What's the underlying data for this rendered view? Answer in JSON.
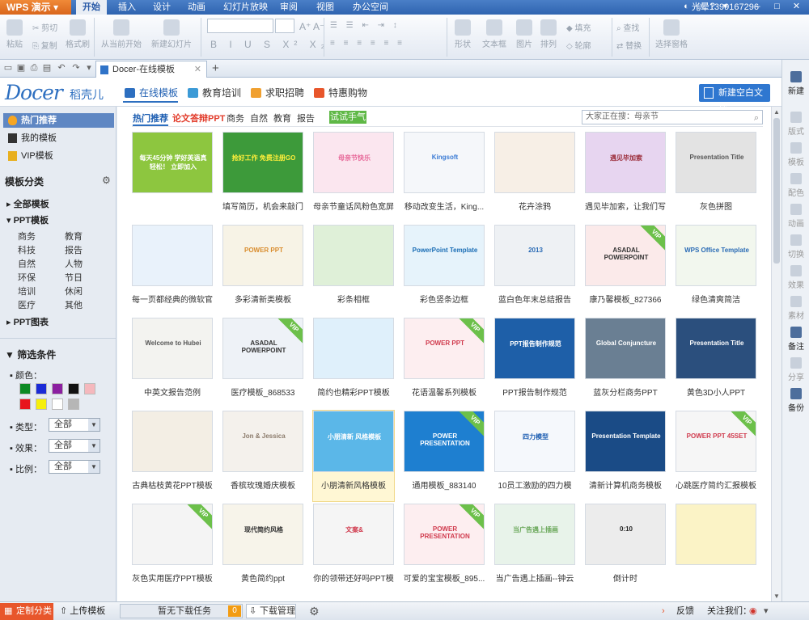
{
  "titlebar": {
    "app": "WPS 演示",
    "menus": [
      "开始",
      "插入",
      "设计",
      "动画",
      "幻灯片放映",
      "审阅",
      "视图",
      "办公空间"
    ],
    "active_menu": "开始",
    "user": "光晕1399167296"
  },
  "ribbon": {
    "paste": "粘贴",
    "cut": "剪切",
    "copy": "复制",
    "format_painter": "格式刷",
    "from_current": "从当前开始",
    "new_slide": "新建幻灯片",
    "shape": "形状",
    "textbox": "文本框",
    "picture": "图片",
    "arrange": "排列",
    "fill": "填充",
    "outline": "轮廓",
    "find": "查找",
    "replace": "替换",
    "select_pane": "选择窗格"
  },
  "tabs": {
    "doc_tab": "Docer-在线模板",
    "add": "+"
  },
  "header": {
    "logo": "Docer",
    "logo_cn": "稻壳儿",
    "tabs": [
      "在线模板",
      "教育培训",
      "求职招聘",
      "特惠购物"
    ],
    "active_tab": "在线模板",
    "new_blank": "新建空白文档"
  },
  "sidebar": {
    "top": [
      "热门推荐",
      "我的模板",
      "VIP模板"
    ],
    "category_title": "模板分类",
    "all": "全部模板",
    "ppt": "PPT模板",
    "ppt_sub": [
      "商务",
      "教育",
      "科技",
      "报告",
      "自然",
      "人物",
      "环保",
      "节日",
      "培训",
      "休闲",
      "医疗",
      "其他"
    ],
    "chart": "PPT图表",
    "filter_title": "筛选条件",
    "color_label": "颜色：",
    "colors": [
      "#0d8a24",
      "#1b2bd6",
      "#8b1fa0",
      "#111111",
      "#f5b8bd",
      "#e8141d",
      "#f6ef0c",
      "#ffffff",
      "#b6b6b6"
    ],
    "type_label": "类型：",
    "effect_label": "效果：",
    "ratio_label": "比例：",
    "all_option": "全部"
  },
  "main": {
    "filters": [
      "热门推荐",
      "论文答辩PPT",
      "商务",
      "自然",
      "教育",
      "报告"
    ],
    "try_button": "试试手气",
    "search_placeholder": "大家正在搜：母亲节",
    "cards": [
      {
        "caption": "",
        "vip": false,
        "color": "#8dc63f",
        "text": "每天45分钟 学好英语真轻松！ 立即加入",
        "fg": "#ffffff"
      },
      {
        "caption": "填写简历，机会来敲门",
        "vip": false,
        "color": "#3d9a3a",
        "text": "抢好工作 免费注册GO",
        "fg": "#ffef3a"
      },
      {
        "caption": "母亲节童话风粉色宽屏",
        "vip": false,
        "color": "#fbe6ef",
        "text": "母亲节快乐",
        "fg": "#e76a9a"
      },
      {
        "caption": "移动改变生活，King...",
        "vip": false,
        "color": "#f5f7fa",
        "text": "Kingsoft",
        "fg": "#3a7bd5"
      },
      {
        "caption": "花卉涂鸦",
        "vip": false,
        "color": "#f7efe6",
        "text": "",
        "fg": "#b0775a"
      },
      {
        "caption": "遇见毕加索，让我们写",
        "vip": false,
        "color": "#e7d5f0",
        "text": "遇见毕加索",
        "fg": "#9b2d3a"
      },
      {
        "caption": "灰色拼图",
        "vip": false,
        "color": "#e3e3e3",
        "text": "Presentation Title",
        "fg": "#555555"
      },
      {
        "caption": "每一页都经典的微软官",
        "vip": false,
        "color": "#e9f2fb",
        "text": "",
        "fg": "#2a6bb5"
      },
      {
        "caption": "多彩清新类模板",
        "vip": false,
        "color": "#f7f3e6",
        "text": "POWER PPT",
        "fg": "#d98c2d"
      },
      {
        "caption": "彩条相框",
        "vip": false,
        "color": "#dff0d8",
        "text": "",
        "fg": "#6aa85a"
      },
      {
        "caption": "彩色竖条边框",
        "vip": false,
        "color": "#e6f3fb",
        "text": "PowerPoint Template",
        "fg": "#1a6db5"
      },
      {
        "caption": "蓝白色年末总结报告",
        "vip": false,
        "color": "#eef1f4",
        "text": "2013",
        "fg": "#2a6bb5"
      },
      {
        "caption": "康乃馨模板_827366",
        "vip": true,
        "color": "#fbeaea",
        "text": "ASADAL POWERPOINT",
        "fg": "#333333"
      },
      {
        "caption": "绿色清爽简洁",
        "vip": false,
        "color": "#f2f7ee",
        "text": "WPS Office Template",
        "fg": "#2a6bb5"
      },
      {
        "caption": "中英文报告范例",
        "vip": false,
        "color": "#f3f3f0",
        "text": "Welcome to Hubei",
        "fg": "#555555"
      },
      {
        "caption": "医疗模板_868533",
        "vip": true,
        "color": "#eef2f7",
        "text": "ASADAL POWERPOINT",
        "fg": "#333333"
      },
      {
        "caption": "简约也精彩PPT模板",
        "vip": false,
        "color": "#dff0fb",
        "text": "",
        "fg": "#3a8cc5"
      },
      {
        "caption": "花语温馨系列模板",
        "vip": true,
        "color": "#fdeef0",
        "text": "POWER PPT",
        "fg": "#d03a4d"
      },
      {
        "caption": "PPT报告制作规范",
        "vip": false,
        "color": "#1e5fa8",
        "text": "PPT报告制作规范",
        "fg": "#ffffff"
      },
      {
        "caption": "蓝灰分栏商务PPT",
        "vip": false,
        "color": "#6a7f93",
        "text": "Global Conjuncture",
        "fg": "#ffffff"
      },
      {
        "caption": "黄色3D小人PPT",
        "vip": false,
        "color": "#2b4f7d",
        "text": "Presentation Title",
        "fg": "#ffffff"
      },
      {
        "caption": "古典枯枝黄花PPT模板",
        "vip": false,
        "color": "#f3eee4",
        "text": "",
        "fg": "#8a6a3a"
      },
      {
        "caption": "香槟玫瑰婚庆模板",
        "vip": false,
        "color": "#f4f1ec",
        "text": "Jon & Jessica",
        "fg": "#8a7a6a"
      },
      {
        "caption": "小朋清新风格模板",
        "vip": false,
        "color": "#5bb7e8",
        "text": "小朋清新 风格模板",
        "fg": "#ffffff"
      },
      {
        "caption": "通用模板_883140",
        "vip": true,
        "color": "#1e7fd0",
        "text": "POWER PRESENTATION",
        "fg": "#ffffff"
      },
      {
        "caption": "10员工激励的四力模",
        "vip": false,
        "color": "#f5f8fc",
        "text": "四力模型",
        "fg": "#1f5fb2"
      },
      {
        "caption": "清新计算机商务模板",
        "vip": false,
        "color": "#1a4b86",
        "text": "Presentation Template",
        "fg": "#ffffff"
      },
      {
        "caption": "心跳医疗简约汇报模板",
        "vip": true,
        "color": "#f6f6f6",
        "text": "POWER PPT 45SET",
        "fg": "#d03a4d"
      },
      {
        "caption": "灰色实用医疗PPT模板",
        "vip": true,
        "color": "#f4f4f4",
        "text": "",
        "fg": "#d03a4d"
      },
      {
        "caption": "黄色简约ppt",
        "vip": false,
        "color": "#f7f4ea",
        "text": "现代简约风格",
        "fg": "#333333"
      },
      {
        "caption": "你的领带还好吗PPT模",
        "vip": false,
        "color": "#f5f5f5",
        "text": "文案&",
        "fg": "#d03a4d"
      },
      {
        "caption": "可爱的宝宝模板_895...",
        "vip": true,
        "color": "#fdeef0",
        "text": "POWER PRESENTATION",
        "fg": "#d03a4d"
      },
      {
        "caption": "当广告遇上插画--钟云",
        "vip": false,
        "color": "#e8f3ea",
        "text": "当广告遇上插画",
        "fg": "#6aa85a"
      },
      {
        "caption": "倒计时",
        "vip": false,
        "color": "#ececec",
        "text": "0:10",
        "fg": "#222222"
      },
      {
        "caption": "",
        "vip": false,
        "color": "#fbf3c6",
        "text": "",
        "fg": "#d9b200"
      }
    ]
  },
  "rightbar": {
    "items": [
      "新建",
      "版式",
      "模板",
      "配色",
      "动画",
      "切换",
      "效果",
      "素材",
      "备注",
      "分享",
      "备份"
    ],
    "active": [
      "新建",
      "备注",
      "备份"
    ]
  },
  "statusbar": {
    "custom": "定制分类",
    "upload": "上传模板",
    "tasks": "暂无下载任务",
    "task_count": "0",
    "download_mgr": "下载管理",
    "feedback": "反馈",
    "follow": "关注我们："
  }
}
